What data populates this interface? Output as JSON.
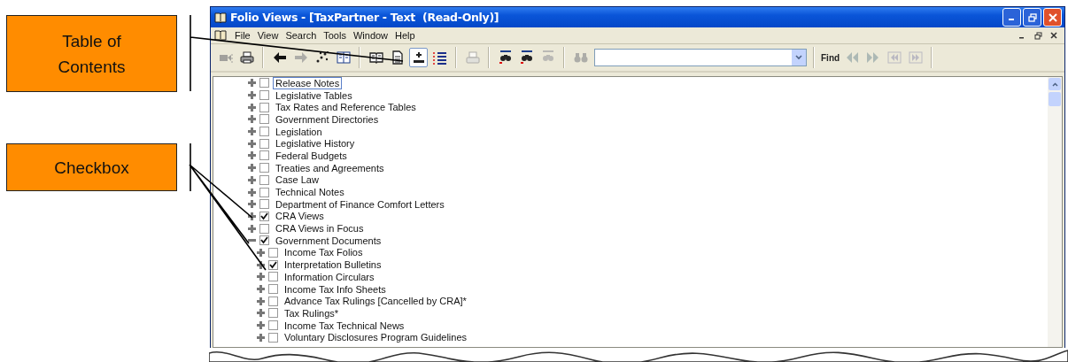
{
  "callouts": [
    {
      "label": "Table of Contents"
    },
    {
      "label": "Checkbox"
    }
  ],
  "window": {
    "title": "Folio Views - [TaxPartner - Text  (Read-Only)]"
  },
  "menu_bar": {
    "items": [
      "File",
      "View",
      "Search",
      "Tools",
      "Window",
      "Help"
    ]
  },
  "toolbar": {
    "buttons": [
      {
        "kind": "export",
        "disabled": true,
        "pressed": false
      },
      {
        "kind": "print",
        "disabled": false,
        "pressed": false
      },
      {
        "kind": "separator"
      },
      {
        "kind": "back",
        "disabled": false,
        "pressed": false
      },
      {
        "kind": "forward",
        "disabled": true,
        "pressed": false
      },
      {
        "kind": "scatter",
        "disabled": false,
        "pressed": false
      },
      {
        "kind": "columns",
        "disabled": false,
        "pressed": false
      },
      {
        "kind": "separator"
      },
      {
        "kind": "book",
        "disabled": false,
        "pressed": false
      },
      {
        "kind": "document",
        "disabled": false,
        "pressed": false
      },
      {
        "kind": "toc",
        "disabled": false,
        "pressed": true
      },
      {
        "kind": "list",
        "disabled": false,
        "pressed": false
      },
      {
        "kind": "separator"
      },
      {
        "kind": "print-preview",
        "disabled": true,
        "pressed": false
      },
      {
        "kind": "separator"
      },
      {
        "kind": "hit-first",
        "disabled": false,
        "pressed": false
      },
      {
        "kind": "hit-second",
        "disabled": false,
        "pressed": false
      },
      {
        "kind": "hit-clear",
        "disabled": true,
        "pressed": false
      },
      {
        "kind": "separator"
      },
      {
        "kind": "binoculars",
        "disabled": true,
        "pressed": false
      }
    ],
    "find_label": "Find",
    "find_buttons": [
      {
        "kind": "prev",
        "disabled": true
      },
      {
        "kind": "next",
        "disabled": true
      },
      {
        "kind": "first",
        "disabled": true
      },
      {
        "kind": "last",
        "disabled": true
      }
    ]
  },
  "tree": [
    {
      "label": "Release Notes",
      "checked": false,
      "expanded": false,
      "selected": true
    },
    {
      "label": "Legislative Tables",
      "checked": false,
      "expanded": false,
      "selected": false
    },
    {
      "label": "Tax Rates and Reference Tables",
      "checked": false,
      "expanded": false,
      "selected": false
    },
    {
      "label": "Government Directories",
      "checked": false,
      "expanded": false,
      "selected": false
    },
    {
      "label": "Legislation",
      "checked": false,
      "expanded": false,
      "selected": false
    },
    {
      "label": "Legislative History",
      "checked": false,
      "expanded": false,
      "selected": false
    },
    {
      "label": "Federal Budgets",
      "checked": false,
      "expanded": false,
      "selected": false
    },
    {
      "label": "Treaties and Agreements",
      "checked": false,
      "expanded": false,
      "selected": false
    },
    {
      "label": "Case Law",
      "checked": false,
      "expanded": false,
      "selected": false
    },
    {
      "label": "Technical Notes",
      "checked": false,
      "expanded": false,
      "selected": false
    },
    {
      "label": "Department of Finance Comfort Letters",
      "checked": false,
      "expanded": false,
      "selected": false
    },
    {
      "label": "CRA Views",
      "checked": true,
      "expanded": false,
      "selected": false
    },
    {
      "label": "CRA Views in Focus",
      "checked": false,
      "expanded": false,
      "selected": false
    },
    {
      "label": "Government Documents",
      "checked": true,
      "expanded": true,
      "selected": false,
      "children": [
        {
          "label": "Income Tax Folios",
          "checked": false,
          "expanded": false,
          "selected": false
        },
        {
          "label": "Interpretation Bulletins",
          "checked": true,
          "expanded": false,
          "selected": false
        },
        {
          "label": "Information Circulars",
          "checked": false,
          "expanded": false,
          "selected": false
        },
        {
          "label": "Income Tax Info Sheets",
          "checked": false,
          "expanded": false,
          "selected": false
        },
        {
          "label": "Advance Tax Rulings [Cancelled by CRA]*",
          "checked": false,
          "expanded": false,
          "selected": false
        },
        {
          "label": "Tax Rulings*",
          "checked": false,
          "expanded": false,
          "selected": false
        },
        {
          "label": "Income Tax Technical News",
          "checked": false,
          "expanded": false,
          "selected": false
        },
        {
          "label": "Voluntary Disclosures Program Guidelines",
          "checked": false,
          "expanded": false,
          "selected": false
        }
      ]
    }
  ]
}
